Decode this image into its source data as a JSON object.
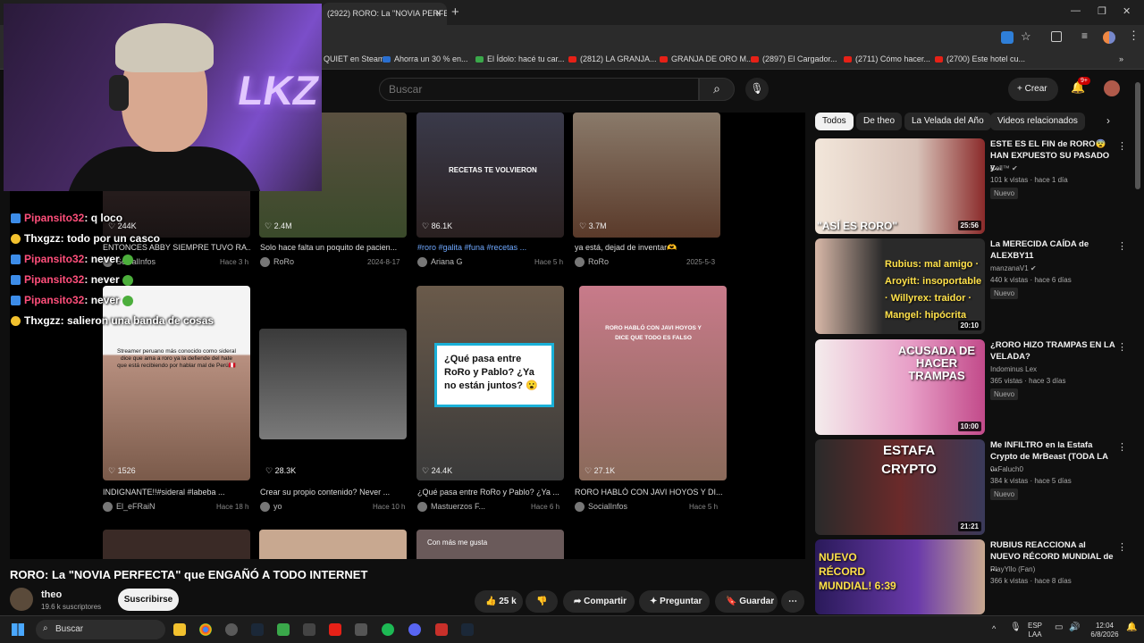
{
  "browser": {
    "tab_title": "(2922) RORO: La \"NOVIA PERFE",
    "new_tab": "+",
    "tab_close": "×",
    "window_controls": [
      "—",
      "❐",
      "✕"
    ]
  },
  "bookmarks": [
    "QUIET en Steam",
    "Ahorra un 30 % en...",
    "El Ídolo: hacé tu car...",
    "(2812) LA GRANJA...",
    "GRANJA DE ORO M...",
    "(2897) El Cargador...",
    "(2711) Cómo hacer...",
    "(2700) Este hotel cu..."
  ],
  "header": {
    "search_placeholder": "Buscar",
    "create_label": "+ Crear",
    "notif_badge": "9+"
  },
  "overlay": {
    "neon_text": "LKZ"
  },
  "chat": [
    {
      "name": "Pipansito32",
      "name_color": "pink",
      "badge": "blue",
      "message": ": q loco"
    },
    {
      "name": "Thxgzz",
      "name_color": "white",
      "badge": "yellow",
      "message": ": todo por un casco"
    },
    {
      "name": "Pipansito32",
      "name_color": "pink",
      "badge": "blue",
      "message": ": never"
    },
    {
      "name": "Pipansito32",
      "name_color": "pink",
      "badge": "blue",
      "message": ": never"
    },
    {
      "name": "Pipansito32",
      "name_color": "pink",
      "badge": "blue",
      "message": ": never"
    },
    {
      "name": "Thxgzz",
      "name_color": "white",
      "badge": "yellow",
      "message": ": salieron una banda de cosas"
    }
  ],
  "grid_row1": [
    {
      "likes": "♡ 244K",
      "title": "ENTONCES ABBY SIEMPRE TUVO RA...",
      "user": "SocialInfos",
      "date": "Hace 3 h"
    },
    {
      "likes": "♡ 2.4M",
      "title": "Solo hace falta un poquito de pacien...",
      "user": "RoRo",
      "date": "2024-8-17"
    },
    {
      "likes": "♡ 86.1K",
      "title": "#roro #galita #funa #recetas ...",
      "user": "Ariana G",
      "date": "Hace 5 h",
      "overlay": "RECETAS TE VOLVIERON"
    },
    {
      "likes": "♡ 3.7M",
      "title": "ya está, dejad de inventar🫶",
      "user": "RoRo",
      "date": "2025-5-3"
    }
  ],
  "grid_row2": [
    {
      "likes": "♡ 1526",
      "title": "INDIGNANTE!!#sideral #labeba ...",
      "user": "El_eFRaiN",
      "date": "Hace 18 h",
      "overlay": "Streamer peruano más conocido como sideral dice que ama a roro ya la defiende del hate que está recibiendo por hablar mal de Perú🇵🇪"
    },
    {
      "likes": "♡ 28.3K",
      "title": "Crear su propio contenido? Never ...",
      "user": "yo",
      "date": "Hace 10 h"
    },
    {
      "likes": "♡ 24.4K",
      "title": "¿Qué pasa entre RoRo y Pablo? ¿Ya ...",
      "user": "Mastuerzos F...",
      "date": "Hace 6 h",
      "overlay": "¿Qué pasa entre RoRo y Pablo? ¿Ya no están juntos? 😮"
    },
    {
      "likes": "♡ 27.1K",
      "title": "RORO HABLÓ CON JAVI HOYOS Y DI...",
      "user": "SocialInfos",
      "date": "Hace 5 h",
      "overlay": "RORO HABLÓ CON JAVI HOYOS Y DICE QUE TODO ES FALSO"
    }
  ],
  "grid_row3_overlay": "Con más me gusta",
  "video": {
    "title": "RORO: La \"NOVIA PERFECTA\" que ENGAÑÓ A TODO INTERNET",
    "channel": "theo",
    "subscribers": "19.6 k suscriptores",
    "subscribe_label": "Suscribirse",
    "likes": "25 k",
    "share_label": "Compartir",
    "ask_label": "Preguntar",
    "save_label": "Guardar"
  },
  "chips": [
    "Todos",
    "De theo",
    "La Velada del Año",
    "Videos relacionados"
  ],
  "related": [
    {
      "title": "ESTE ES EL FIN de RORO😨 HAN EXPUESTO SU PASADO y...",
      "channel": "Cell™ ✔",
      "meta": "101 k vistas · hace 1 día",
      "badge": "Nuevo",
      "duration": "25:56",
      "thumb_text": "\"ASÍ ES RORO\"",
      "thumb_color": "#8a2a2a"
    },
    {
      "title": "La MERECIDA CAÍDA de ALEXBY11",
      "channel": "manzanaV1 ✔",
      "meta": "440 k vistas · hace 6 días",
      "badge": "Nuevo",
      "duration": "20:10",
      "thumb_text": "Rubius: mal amigo · Aroyitt: insoportable · Willyrex: traidor · Mangel: hipócrita",
      "thumb_color": "#2a2a2a"
    },
    {
      "title": "¿RORO HIZO TRAMPAS EN LA VELADA?",
      "channel": "Indominus Lex",
      "meta": "365 vistas · hace 3 días",
      "badge": "Nuevo",
      "duration": "10:00",
      "thumb_text": "ACUSADA DE HACER TRAMPAS",
      "thumb_color": "#c24a8a"
    },
    {
      "title": "Me INFILTRO en la Estafa Crypto de MrBeast (TODA LA ...",
      "channel": "0xFaluch0",
      "meta": "384 k vistas · hace 5 días",
      "badge": "Nuevo",
      "duration": "21:21",
      "thumb_text": "ESTAFA CRYPTO",
      "thumb_color": "#3a1a1a"
    },
    {
      "title": "RUBIUS REACCIONA al NUEVO RÉCORD MUNDIAL de ...",
      "channel": "PlayYllo (Fan)",
      "meta": "366 k vistas · hace 8 días",
      "badge": "",
      "duration": "",
      "thumb_text": "NUEVO RÉCORD MUNDIAL! 6:39",
      "thumb_color": "#3a1a6a"
    }
  ],
  "taskbar": {
    "search_label": "Buscar",
    "lang": "ESP",
    "lang2": "LAA",
    "time": "12:04",
    "date": "6/8/2026"
  }
}
